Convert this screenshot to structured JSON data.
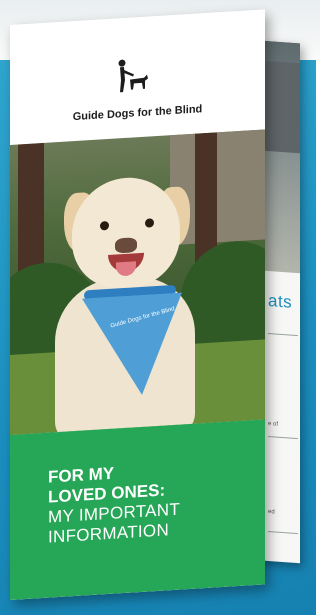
{
  "back_panel": {
    "heading_fragment": "ats",
    "text_fragments": [
      "e of",
      "ed"
    ]
  },
  "brochure": {
    "org_name": "Guide Dogs for the Blind",
    "bandana_text": "Guide Dogs for the Blind",
    "headline_line1": "FOR MY",
    "headline_line2": "LOVED ONES:",
    "headline_line3": "MY IMPORTANT",
    "headline_line4": "INFORMATION"
  },
  "colors": {
    "teal_background": "#1b8fbf",
    "green_band": "#26a657",
    "bandana_blue": "#4f9fd6"
  }
}
